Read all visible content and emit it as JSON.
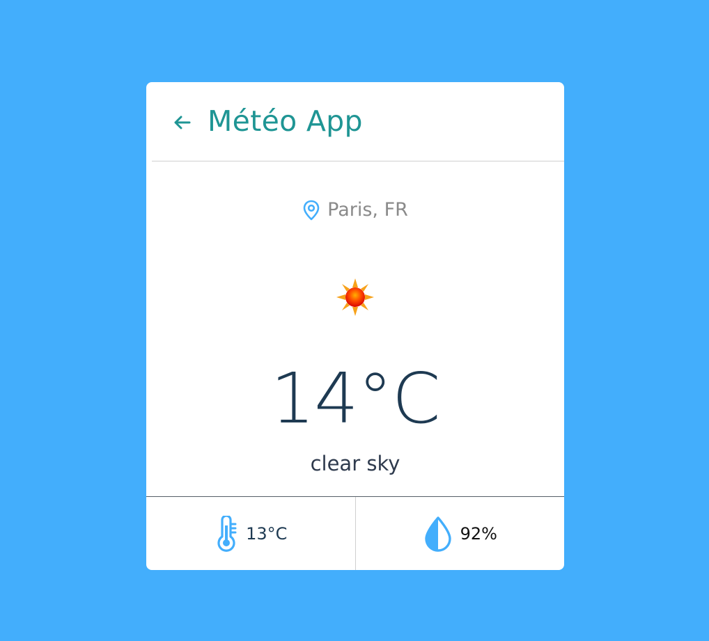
{
  "app": {
    "title": "Météo App",
    "back_icon": "arrow-left-icon"
  },
  "location": {
    "icon": "map-pin-icon",
    "text": "Paris, FR"
  },
  "weather": {
    "icon": "sun-icon",
    "temperature": "14°C",
    "description": "clear sky"
  },
  "details": {
    "feels_like": {
      "icon": "thermometer-icon",
      "value": "13°C"
    },
    "humidity": {
      "icon": "water-drop-icon",
      "value": "92%"
    }
  },
  "colors": {
    "background": "#43aefc",
    "title": "#1f9594",
    "accent_icon": "#43aefc",
    "temperature": "#1e3a52"
  }
}
